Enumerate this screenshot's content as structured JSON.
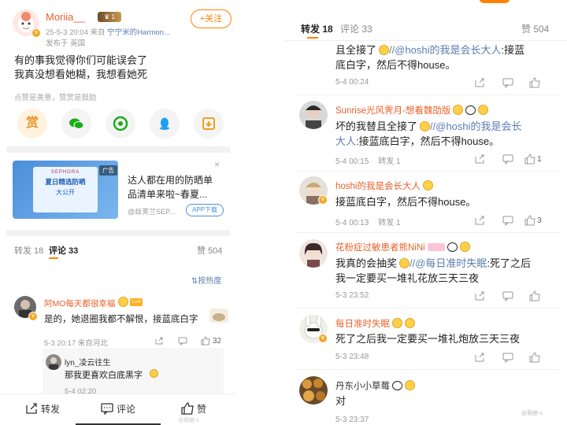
{
  "left": {
    "post": {
      "author": "Moriia__",
      "follow_label": "+关注",
      "date": "25-5-3 20:04",
      "source_prefix": "来自",
      "source_name": "宁宁米的Harmon...",
      "published_from": "发布于 英国",
      "text_line1": "有的事我觉得你们可能误会了",
      "text_line2": "我真没想看她糊，我想看她死",
      "tip": "点赞是美意，赞赏是鼓励",
      "reward_label": "赏"
    },
    "ad": {
      "tag": "广告",
      "brand": "SEPHORA",
      "img_line1": "夏日精选防晒",
      "img_line2": "大公开",
      "title": "达人都在用的防晒单品清单来啦~春夏...",
      "from": "@丝芙兰SEP...",
      "app_button": "APP下载",
      "close": "×"
    },
    "tabs": {
      "repost": "转发 18",
      "comment": "评论 33",
      "like": "赞 504"
    },
    "sort_label": "按热度",
    "comments": [
      {
        "name": "阿MO每天都很幸福",
        "level": "Lv4",
        "text": "是的，她退圈我都不解恨，接蓝底白字",
        "meta": "5-3 20:17  来自河北",
        "likes": "32"
      }
    ],
    "reply": {
      "name": "lyn_凌云往生",
      "text": "那我更喜欢白底黑字",
      "meta": "5-4 02:20"
    },
    "bottom": {
      "repost": "转发",
      "comment": "评论",
      "like": "赞"
    },
    "watermark": "@萌娘-s"
  },
  "right": {
    "tabs": {
      "repost": "转发 18",
      "comment": "评论 33",
      "like": "赞 504"
    },
    "comments": [
      {
        "line1_a": "且全接了",
        "line1_b": "//",
        "line1_link": "@hoshi的我是会长大人",
        "line1_c": ":接蓝",
        "line2": "底白字，然后不得house。",
        "meta": "5-4 00:24"
      },
      {
        "name": "Sunrise光风霁月-想看魏劭版",
        "line1_a": "坏的我替且全接了",
        "line1_b": "//",
        "line1_link": "@hoshi的我是会长",
        "line2_link": "大人",
        "line2": ":接蓝底白字，然后不得house。",
        "meta": "5-4 00:15",
        "repost": "转发 1",
        "likes": "1"
      },
      {
        "name": "hoshi的我是会长大人",
        "line1": "接蓝底白字，然后不得house。",
        "meta": "5-4 00:13",
        "repost": "转发 1",
        "likes": "3"
      },
      {
        "name": "花粉症过敏患者熊NiNi",
        "line1_a": "我真的会抽奖",
        "line1_link": "//@每日准时失眠",
        "line1_c": ":死了之后",
        "line2": "我一定要买一堆礼花放三天三夜",
        "meta": "5-3 23:52"
      },
      {
        "name": "每日准时失眠",
        "line1": "死了之后我一定要买一堆礼炮放三天三夜",
        "meta": "5-3 23:48"
      },
      {
        "name": "丹东小小草莓",
        "line1": "对",
        "meta": "5-3 23:37"
      }
    ],
    "watermark": "@萌娘-s"
  },
  "colors": {
    "accent": "#ff8200",
    "name": "#e8612c",
    "link": "#5a7eb0"
  }
}
